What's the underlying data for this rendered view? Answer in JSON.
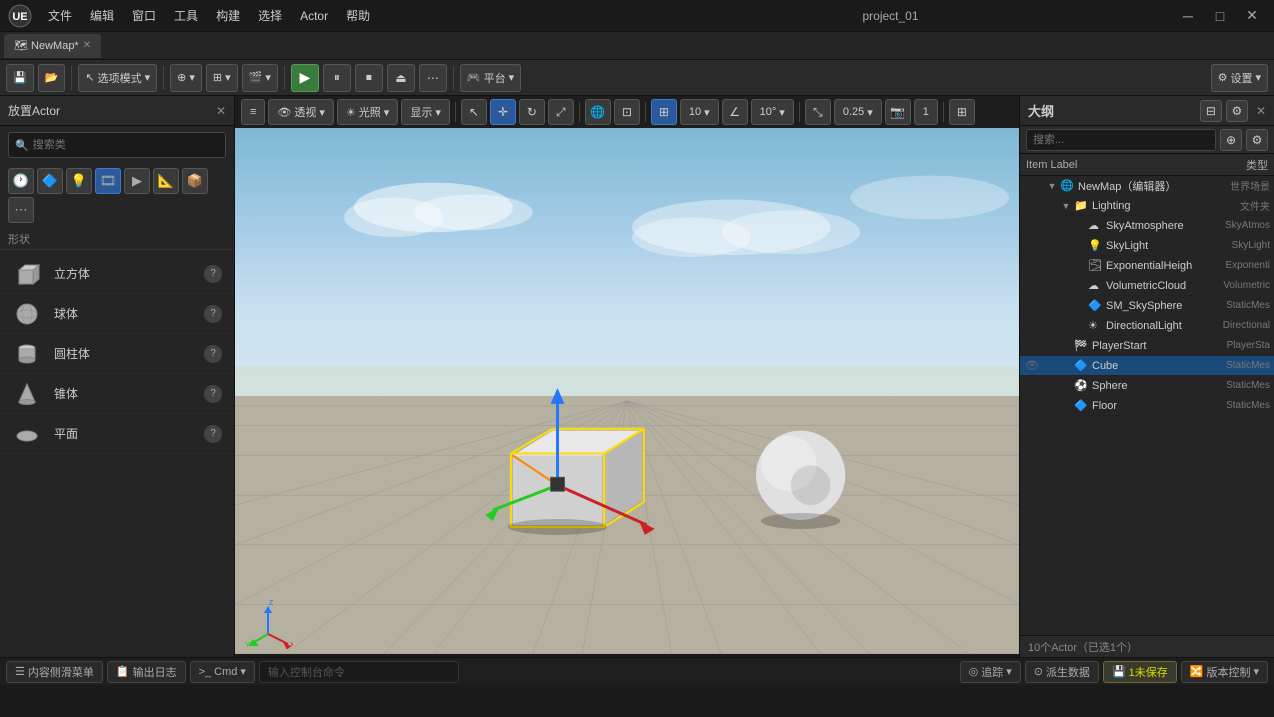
{
  "titleBar": {
    "title": "project_01",
    "menu": [
      "文件",
      "编辑",
      "窗口",
      "工具",
      "构建",
      "选择",
      "Actor",
      "帮助"
    ]
  },
  "tabBar": {
    "tabs": [
      {
        "label": "NewMap*",
        "modified": true
      }
    ]
  },
  "mainToolbar": {
    "modeBtn": "选项模式",
    "addBtn": "+",
    "playBtn": "▶",
    "pauseBtn": "⏸",
    "stopBtn": "⏹",
    "ejectBtn": "⏏",
    "platformBtn": "平台",
    "settingsBtn": "设置"
  },
  "leftPanel": {
    "header": "放置Actor",
    "searchPlaceholder": "搜索类",
    "categorySections": [
      {
        "name": "形状",
        "label": "形状"
      }
    ],
    "shapes": [
      {
        "name": "立方体",
        "icon": "cube"
      },
      {
        "name": "球体",
        "icon": "sphere"
      },
      {
        "name": "圆柱体",
        "icon": "cylinder"
      },
      {
        "name": "锥体",
        "icon": "cone"
      },
      {
        "name": "平面",
        "icon": "plane"
      }
    ]
  },
  "viewport": {
    "toolbar": {
      "menuIcon": "≡",
      "perspBtn": "透视",
      "lightBtn": "光照",
      "showBtn": "显示",
      "gridSize": "10",
      "rotSnap": "10°",
      "scaleSnap": "0.25",
      "camSpeed": "1"
    }
  },
  "outliner": {
    "title": "大纲",
    "searchPlaceholder": "搜索...",
    "columns": {
      "label": "Item Label",
      "type": "类型"
    },
    "tree": [
      {
        "id": "newmap",
        "indent": 0,
        "arrow": "▼",
        "icon": "🌐",
        "name": "NewMap（编辑器）",
        "type": "世界场景",
        "hasEye": false,
        "selected": false
      },
      {
        "id": "lighting",
        "indent": 1,
        "arrow": "▼",
        "icon": "📁",
        "name": "Lighting",
        "type": "文件夹",
        "hasEye": false,
        "selected": false
      },
      {
        "id": "skyatmos",
        "indent": 2,
        "arrow": "",
        "icon": "☁",
        "name": "SkyAtmosphere",
        "type": "SkyAtmos",
        "hasEye": false,
        "selected": false
      },
      {
        "id": "skylight",
        "indent": 2,
        "arrow": "",
        "icon": "💡",
        "name": "SkyLight",
        "type": "SkyLight",
        "hasEye": false,
        "selected": false
      },
      {
        "id": "expheight",
        "indent": 2,
        "arrow": "",
        "icon": "🌫",
        "name": "ExponentialHeigh",
        "type": "Exponenti",
        "hasEye": false,
        "selected": false
      },
      {
        "id": "volcloud",
        "indent": 2,
        "arrow": "",
        "icon": "☁",
        "name": "VolumetricCloud",
        "type": "Volumetric",
        "hasEye": false,
        "selected": false
      },
      {
        "id": "skysphere",
        "indent": 2,
        "arrow": "",
        "icon": "🔷",
        "name": "SM_SkySphere",
        "type": "StaticMes",
        "hasEye": false,
        "selected": false
      },
      {
        "id": "dirlight",
        "indent": 2,
        "arrow": "",
        "icon": "☀",
        "name": "DirectionalLight",
        "type": "Directional",
        "hasEye": false,
        "selected": false
      },
      {
        "id": "playerstart",
        "indent": 1,
        "arrow": "",
        "icon": "🏁",
        "name": "PlayerStart",
        "type": "PlayerSta",
        "hasEye": false,
        "selected": false
      },
      {
        "id": "cube",
        "indent": 1,
        "arrow": "",
        "icon": "🔷",
        "name": "Cube",
        "type": "StaticMes",
        "hasEye": true,
        "selected": true
      },
      {
        "id": "sphere",
        "indent": 1,
        "arrow": "",
        "icon": "⚽",
        "name": "Sphere",
        "type": "StaticMes",
        "hasEye": false,
        "selected": false
      },
      {
        "id": "floor",
        "indent": 1,
        "arrow": "",
        "icon": "🔷",
        "name": "Floor",
        "type": "StaticMes",
        "hasEye": false,
        "selected": false
      }
    ],
    "footer": "10个Actor（已选1个）"
  },
  "statusBar": {
    "leftItems": [
      "内容侧滑菜单",
      "输出日志",
      "Cmd",
      "输入控制台命令"
    ],
    "rightItems": [
      "追踪",
      "派生数据",
      "1未保存",
      "版本控制"
    ]
  }
}
